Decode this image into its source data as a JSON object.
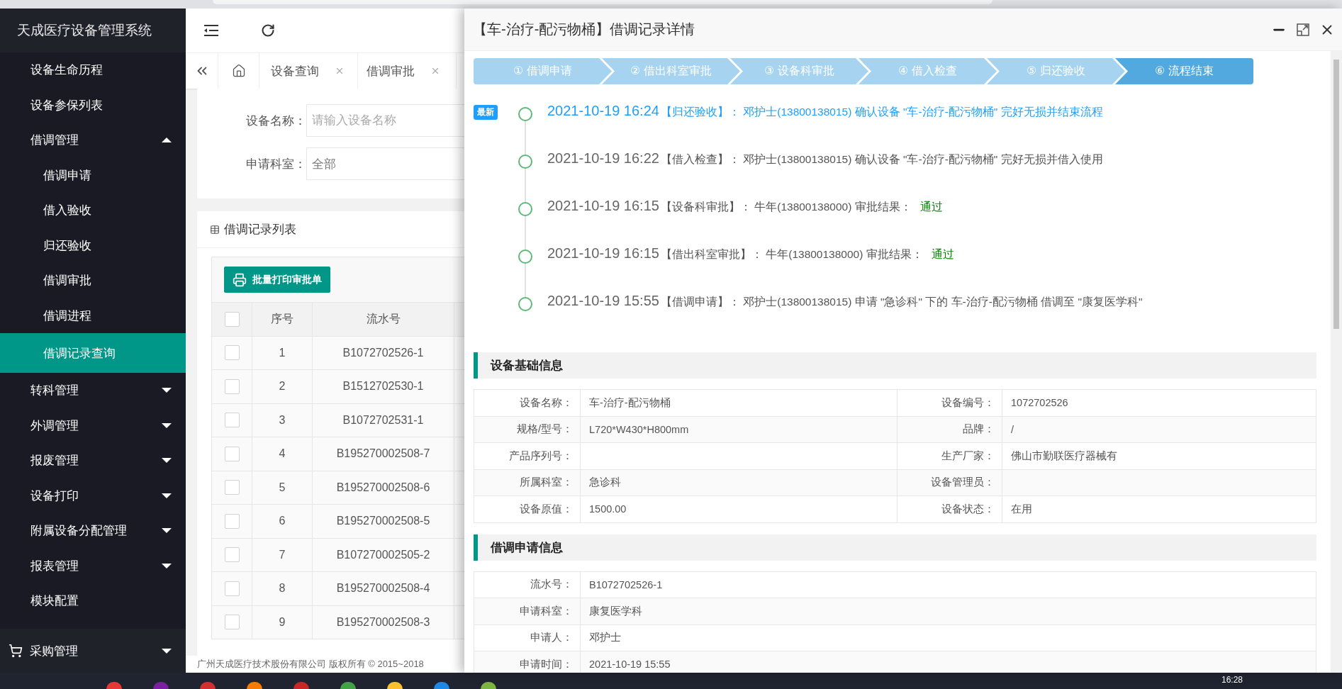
{
  "sidebar": {
    "title": "天成医疗设备管理系统",
    "items": [
      {
        "label": "设备生命历程",
        "kind": "link",
        "selected": false
      },
      {
        "label": "设备参保列表",
        "kind": "link",
        "selected": false
      },
      {
        "label": "借调管理",
        "kind": "group",
        "expanded": true,
        "selected": false,
        "children": [
          {
            "label": "借调申请",
            "selected": false
          },
          {
            "label": "借入验收",
            "selected": false
          },
          {
            "label": "归还验收",
            "selected": false
          },
          {
            "label": "借调审批",
            "selected": false
          },
          {
            "label": "借调进程",
            "selected": false
          },
          {
            "label": "借调记录查询",
            "selected": true
          }
        ]
      },
      {
        "label": "转科管理",
        "kind": "group",
        "expanded": false,
        "selected": false
      },
      {
        "label": "外调管理",
        "kind": "group",
        "expanded": false,
        "selected": false
      },
      {
        "label": "报废管理",
        "kind": "group",
        "expanded": false,
        "selected": false
      },
      {
        "label": "设备打印",
        "kind": "group",
        "expanded": false,
        "selected": false
      },
      {
        "label": "附属设备分配管理",
        "kind": "group",
        "expanded": false,
        "selected": false
      },
      {
        "label": "报表管理",
        "kind": "group",
        "expanded": false,
        "selected": false
      },
      {
        "label": "模块配置",
        "kind": "link",
        "selected": false
      }
    ],
    "bottom_item": {
      "label": "采购管理",
      "expanded": false
    }
  },
  "tabs": [
    {
      "label": "设备查询",
      "selected": false
    },
    {
      "label": "借调审批",
      "selected": false
    }
  ],
  "search_form": {
    "fields": [
      {
        "label": "设备名称：",
        "kind": "text",
        "placeholder": "请输入设备名称"
      },
      {
        "label": "申请科室：",
        "kind": "select",
        "value": "全部"
      }
    ]
  },
  "record_list": {
    "title": "借调记录列表",
    "select_all_checked": false,
    "print_button": "批量打印审批单",
    "columns": [
      "序号",
      "流水号"
    ],
    "rows": [
      {
        "checked": false,
        "cells": [
          "1",
          "B1072702526-1"
        ]
      },
      {
        "checked": false,
        "cells": [
          "2",
          "B1512702530-1"
        ]
      },
      {
        "checked": false,
        "cells": [
          "3",
          "B1072702531-1"
        ]
      },
      {
        "checked": false,
        "cells": [
          "4",
          "B195270002508-7"
        ]
      },
      {
        "checked": false,
        "cells": [
          "5",
          "B195270002508-6"
        ]
      },
      {
        "checked": false,
        "cells": [
          "6",
          "B195270002508-5"
        ]
      },
      {
        "checked": false,
        "cells": [
          "7",
          "B107270002505-2"
        ]
      },
      {
        "checked": false,
        "cells": [
          "8",
          "B195270002508-4"
        ]
      },
      {
        "checked": false,
        "cells": [
          "9",
          "B195270002508-3"
        ]
      }
    ]
  },
  "footer": "广州天成医疗技术股份有限公司 版权所有 © 2015~2018",
  "modal": {
    "title": "【车-治疗-配污物桶】借调记录详情",
    "steps": [
      {
        "label": "① 借调申请",
        "current": false
      },
      {
        "label": "② 借出科室审批",
        "current": false
      },
      {
        "label": "③ 设备科审批",
        "current": false
      },
      {
        "label": "④ 借入检查",
        "current": false
      },
      {
        "label": "⑤ 归还验收",
        "current": false
      },
      {
        "label": "⑥ 流程结束",
        "current": true
      }
    ],
    "timeline": [
      {
        "latest": true,
        "badge": "最新",
        "time": "2021-10-19 16:24",
        "detail": "【归还验收】： 邓护士(13800138015) 确认设备 \"车-治疗-配污物桶\" 完好无损并结束流程"
      },
      {
        "latest": false,
        "time": "2021-10-19 16:22",
        "detail": "【借入检查】： 邓护士(13800138015) 确认设备 \"车-治疗-配污物桶\" 完好无损并借入使用"
      },
      {
        "latest": false,
        "time": "2021-10-19 16:15",
        "detail": "【设备科审批】： 牛年(13800138000) 审批结果：",
        "result": "通过"
      },
      {
        "latest": false,
        "time": "2021-10-19 16:15",
        "detail": "【借出科室审批】： 牛年(13800138000) 审批结果：",
        "result": "通过"
      },
      {
        "latest": false,
        "time": "2021-10-19 15:55",
        "detail": "【借调申请】： 邓护士(13800138015) 申请 \"急诊科\" 下的 车-治疗-配污物桶 借调至 \"康复医学科\""
      }
    ],
    "sections": [
      {
        "title": "设备基础信息",
        "rows": [
          [
            {
              "label": "设备名称：",
              "value": "车-治疗-配污物桶"
            },
            {
              "label": "设备编号：",
              "value": "1072702526"
            }
          ],
          [
            {
              "label": "规格/型号：",
              "value": "L720*W430*H800mm"
            },
            {
              "label": "品牌：",
              "value": "/"
            }
          ],
          [
            {
              "label": "产品序列号："
            },
            {
              "label": "生产厂家：",
              "value": "佛山市勤联医疗器械有"
            }
          ],
          [
            {
              "label": "所属科室：",
              "value": "急诊科"
            },
            {
              "label": "设备管理员："
            }
          ],
          [
            {
              "label": "设备原值：",
              "value": "1500.00"
            },
            {
              "label": "设备状态：",
              "value": "在用"
            }
          ]
        ]
      },
      {
        "title": "借调申请信息",
        "rows": [
          [
            {
              "label": "流水号：",
              "value": "B1072702526-1"
            }
          ],
          [
            {
              "label": "申请科室：",
              "value": "康复医学科"
            }
          ],
          [
            {
              "label": "申请人：",
              "value": "邓护士"
            }
          ],
          [
            {
              "label": "申请时间：",
              "value": "2021-10-19 15:55"
            }
          ]
        ]
      }
    ]
  },
  "taskbar": {
    "clock": "16:28"
  }
}
